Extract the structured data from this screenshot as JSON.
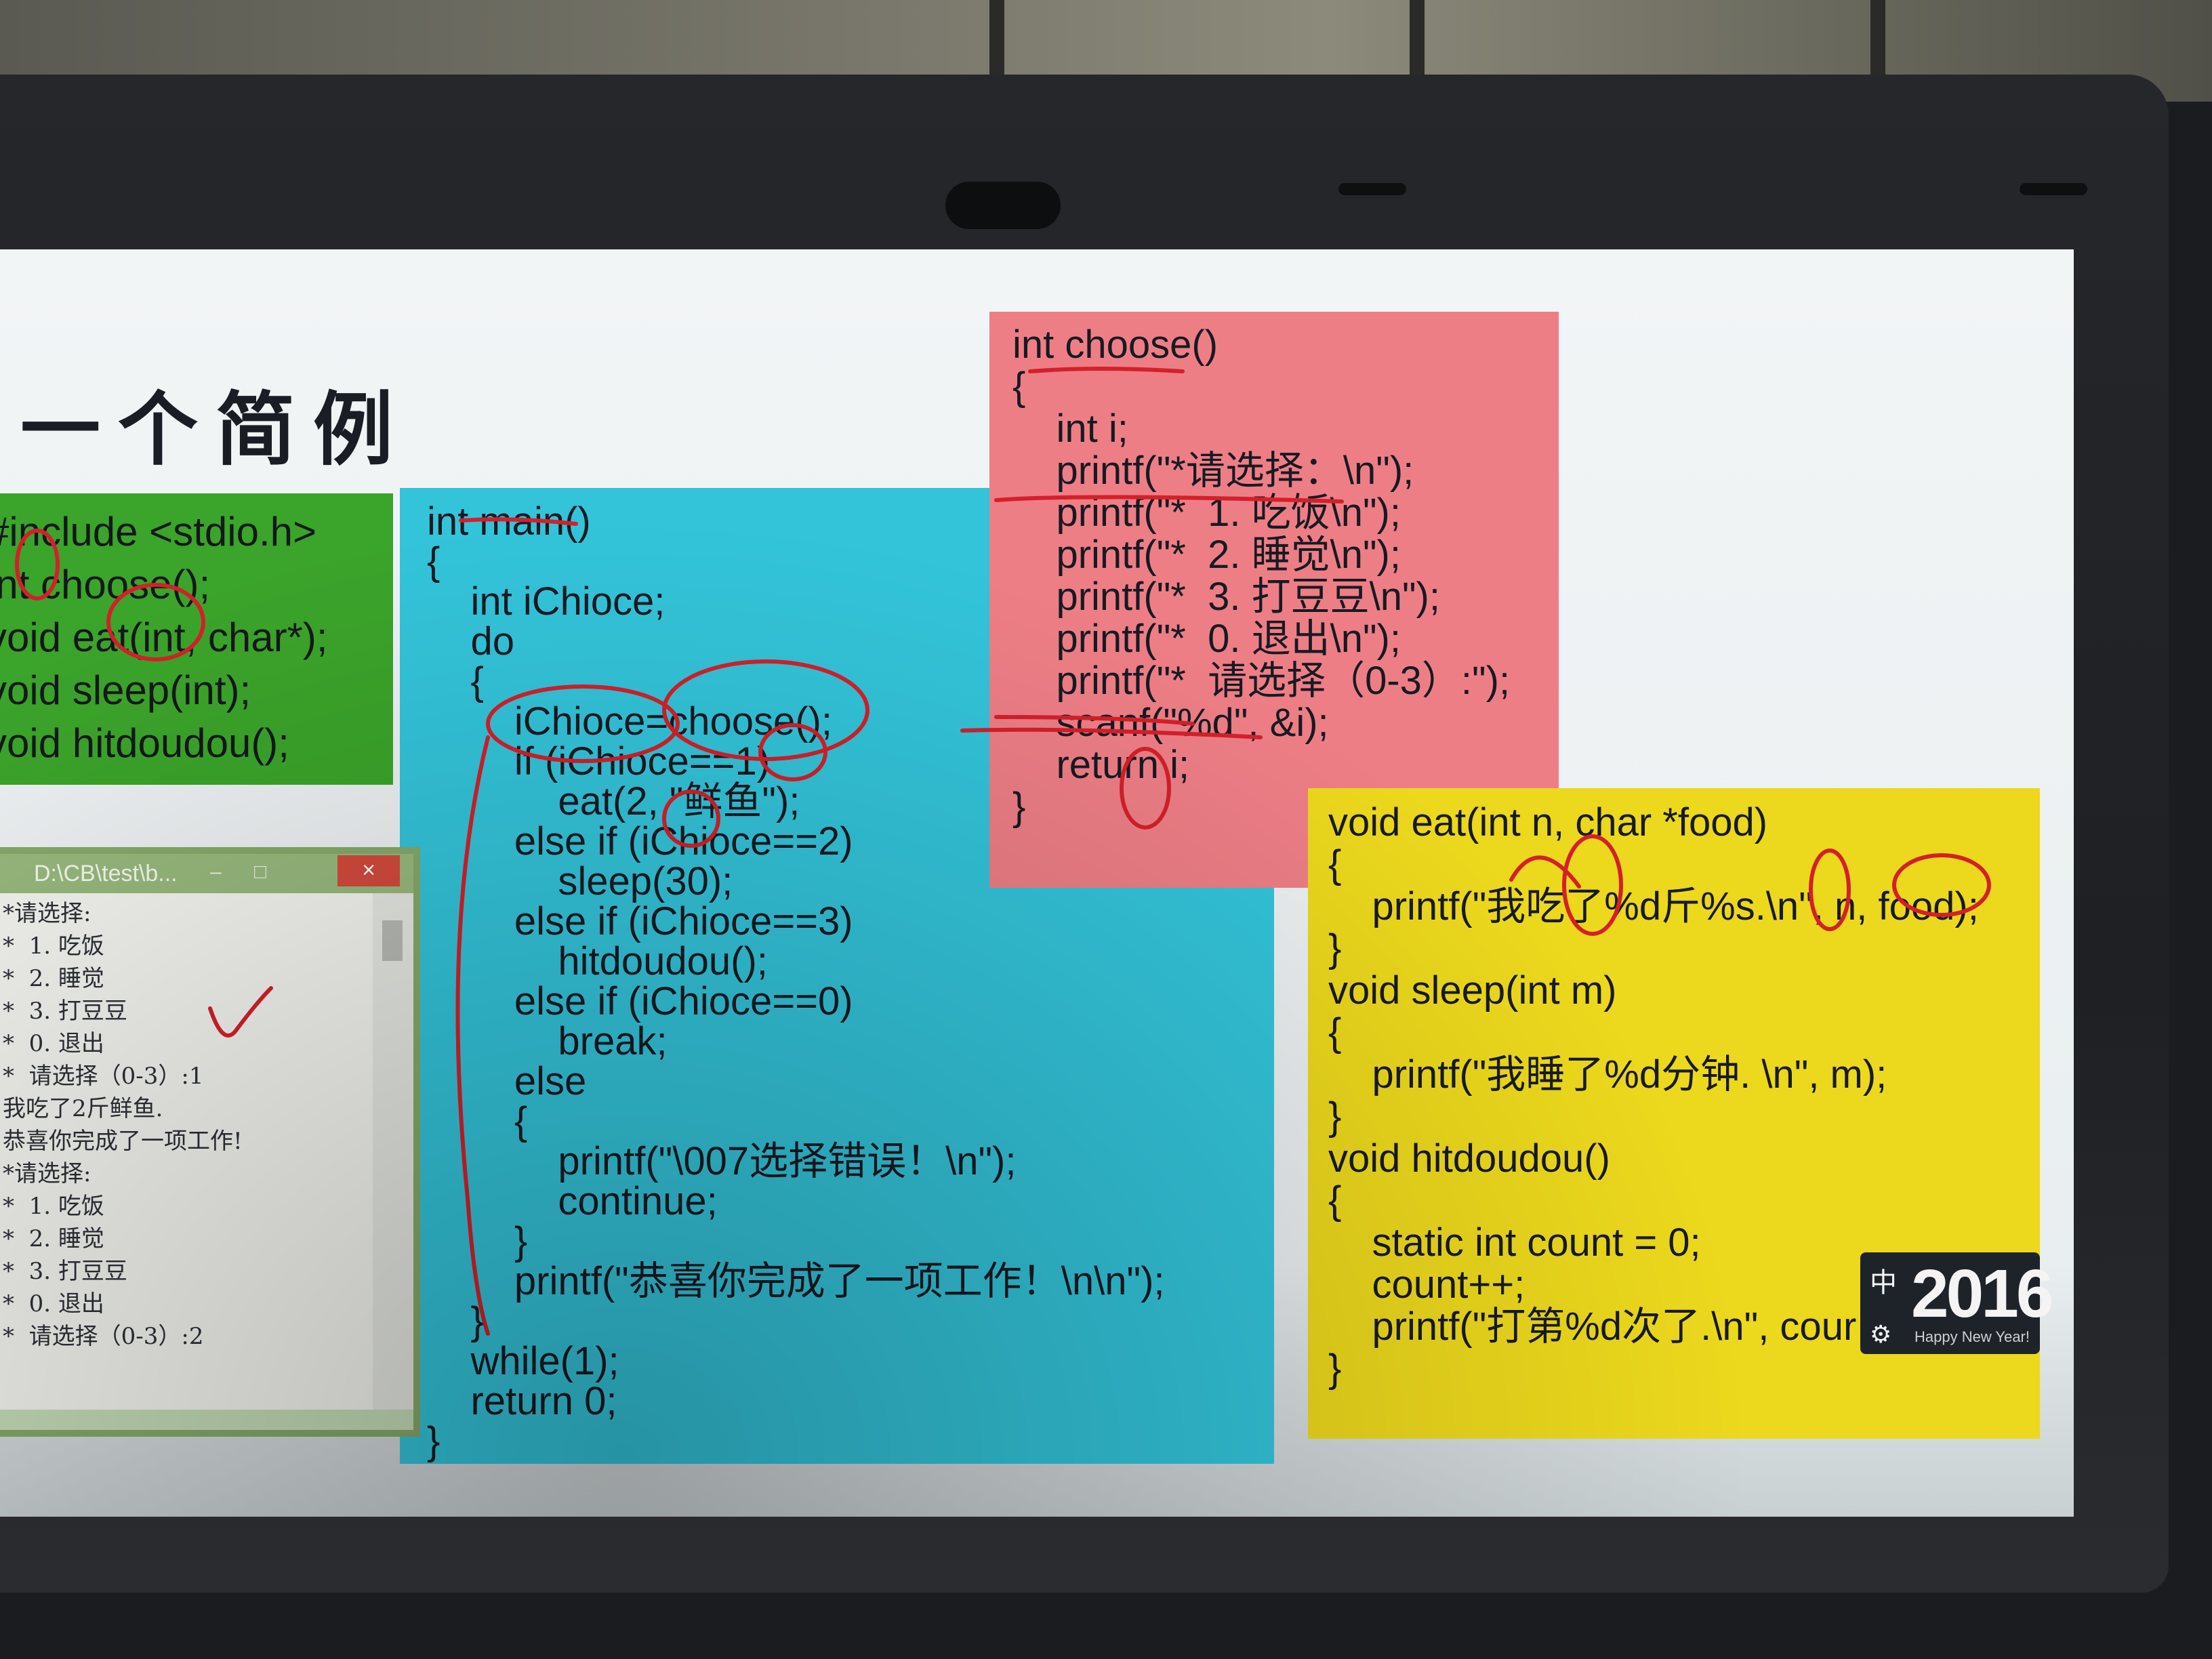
{
  "slide": {
    "title": "一个简例",
    "declarations": [
      "#include <stdio.h>",
      "int choose();",
      "void eat(int, char*);",
      "void sleep(int);",
      "void hitdoudou();"
    ],
    "main_code": [
      "int main()",
      "{",
      "    int iChioce;",
      "    do",
      "    {",
      "        iChioce=choose();",
      "        if (iChioce==1)",
      "            eat(2, \"鲜鱼\");",
      "        else if (iChioce==2)",
      "            sleep(30);",
      "        else if (iChioce==3)",
      "            hitdoudou();",
      "        else if (iChioce==0)",
      "            break;",
      "        else",
      "        {",
      "            printf(\"\\007选择错误！\\n\");",
      "            continue;",
      "        }",
      "        printf(\"恭喜你完成了一项工作！\\n\\n\");",
      "    }",
      "    while(1);",
      "    return 0;",
      "}"
    ],
    "choose_code": [
      "int choose()",
      "{",
      "    int i;",
      "    printf(\"*请选择：\\n\");",
      "    printf(\"*  1. 吃饭\\n\");",
      "    printf(\"*  2. 睡觉\\n\");",
      "    printf(\"*  3. 打豆豆\\n\");",
      "    printf(\"*  0. 退出\\n\");",
      "    printf(\"*  请选择（0-3）:\");",
      "    scanf(\"%d\", &i);",
      "    return i;",
      "}"
    ],
    "funcs_code": [
      "void eat(int n, char *food)",
      "{",
      "    printf(\"我吃了%d斤%s.\\n\", n, food);",
      "}",
      "void sleep(int m)",
      "{",
      "    printf(\"我睡了%d分钟. \\n\", m);",
      "}",
      "void hitdoudou()",
      "{",
      "    static int count = 0;",
      "    count++;",
      "    printf(\"打第%d次了.\\n\", cour",
      "}"
    ]
  },
  "console_window": {
    "title": "D:\\CB\\test\\b...",
    "minimize": "–",
    "restore": "□",
    "close": "×",
    "lines": [
      "*请选择:",
      "*  1. 吃饭",
      "*  2. 睡觉",
      "*  3. 打豆豆",
      "*  0. 退出",
      "*  请选择（0-3）:1",
      "我吃了2斤鲜鱼.",
      "恭喜你完成了一项工作!",
      "",
      "*请选择:",
      "*  1. 吃饭",
      "*  2. 睡觉",
      "*  3. 打豆豆",
      "*  0. 退出",
      "*  请选择（0-3）:2"
    ]
  },
  "tray_badge": {
    "year": "2016",
    "greeting": "Happy New Year!",
    "ime": "中",
    "settings_icon": "gear-icon"
  },
  "colors": {
    "green_panel": "#3ba42a",
    "cyan_panel": "#33c4da",
    "pink_panel": "#ee7e86",
    "yellow_panel": "#ecd81c",
    "annotation_ink": "#d4202a"
  }
}
